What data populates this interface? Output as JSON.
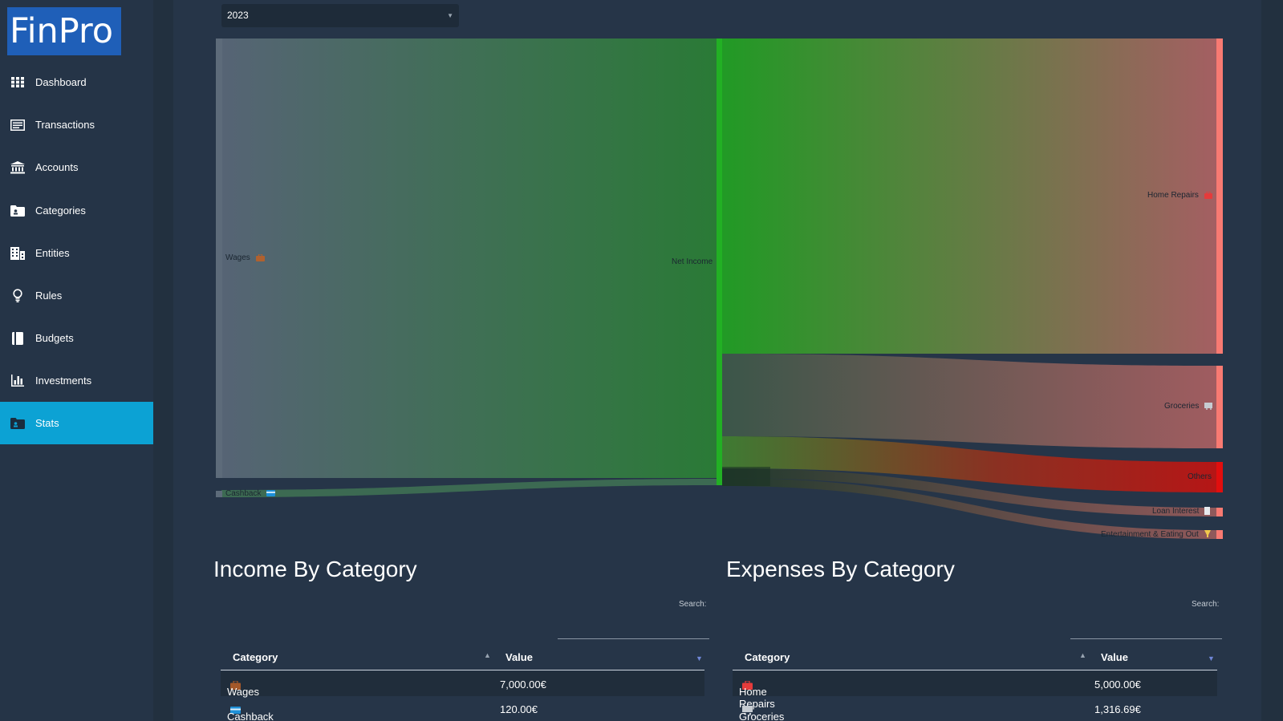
{
  "app": {
    "logo": "FinPro"
  },
  "sidebar": {
    "items": [
      {
        "label": "Dashboard",
        "icon": "grid-icon"
      },
      {
        "label": "Transactions",
        "icon": "list-icon"
      },
      {
        "label": "Accounts",
        "icon": "bank-icon"
      },
      {
        "label": "Categories",
        "icon": "folder-icon"
      },
      {
        "label": "Entities",
        "icon": "building-icon"
      },
      {
        "label": "Rules",
        "icon": "lightbulb-icon"
      },
      {
        "label": "Budgets",
        "icon": "book-icon"
      },
      {
        "label": "Investments",
        "icon": "bar-chart-icon"
      },
      {
        "label": "Stats",
        "icon": "folder-user-icon",
        "active": true
      }
    ]
  },
  "year_select": {
    "value": "2023"
  },
  "sankey": {
    "labels": {
      "wages": "Wages",
      "cashback": "Cashback",
      "net_income": "Net Income",
      "home_repairs": "Home Repairs",
      "groceries": "Groceries",
      "others": "Others",
      "loan_interest": "Loan Interest",
      "entertainment": "Entertainment & Eating Out"
    },
    "colors": {
      "income_node": "#5d6b7a",
      "net_income_node": "#22b024",
      "expense_node": "#f87a72",
      "others_node": "#e10e0e"
    }
  },
  "income": {
    "title": "Income By Category",
    "search_label": "Search:",
    "columns": [
      "Category",
      "Value"
    ],
    "rows": [
      {
        "category": "Wages",
        "value": "7,000.00€",
        "icon": "briefcase-icon"
      },
      {
        "category": "Cashback",
        "value": "120.00€",
        "icon": "credit-card-icon"
      }
    ]
  },
  "expenses": {
    "title": "Expenses By Category",
    "search_label": "Search:",
    "columns": [
      "Category",
      "Value"
    ],
    "rows": [
      {
        "category": "Home Repairs",
        "value": "5,000.00€",
        "icon": "toolbox-icon"
      },
      {
        "category": "Groceries",
        "value": "1,316.69€",
        "icon": "cart-icon"
      }
    ]
  }
}
